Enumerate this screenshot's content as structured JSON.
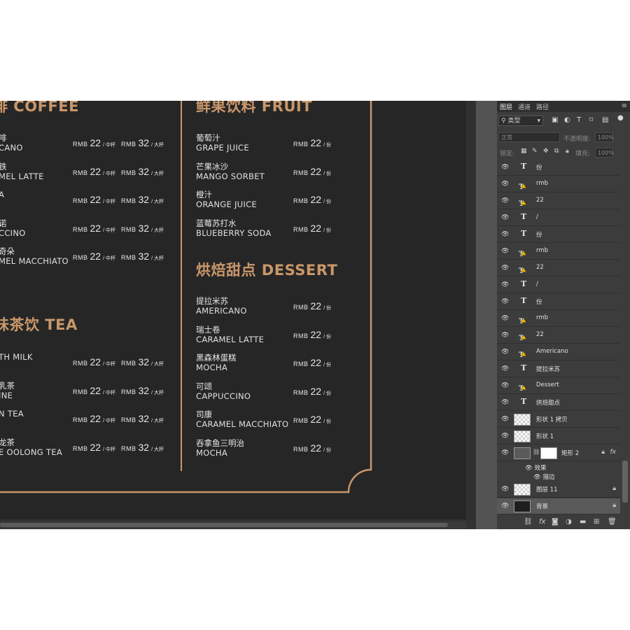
{
  "menu": {
    "coffee_title": "啡 COFFEE",
    "tea_title": "味茶饮 TEA",
    "fruit_title": "鲜果饮料 FRUIT",
    "dessert_title": "烘焙甜点 DESSERT",
    "coffee_items": [
      {
        "cn": "啡",
        "en": "CANO"
      },
      {
        "cn": "铁",
        "en": "MEL LATTE"
      },
      {
        "cn": "",
        "en": "A"
      },
      {
        "cn": "诺",
        "en": "CCINO"
      },
      {
        "cn": "奇朵",
        "en": "MEL MACCHIATO"
      }
    ],
    "tea_items": [
      {
        "cn": "",
        "en": "TH MILK"
      },
      {
        "cn": "乳茶",
        "en": "INE"
      },
      {
        "cn": "",
        "en": "N TEA"
      },
      {
        "cn": "龙茶",
        "en": "E OOLONG TEA"
      }
    ],
    "fruit_items": [
      {
        "cn": "葡萄汁",
        "en": "GRAPE JUICE"
      },
      {
        "cn": "芒果冰沙",
        "en": "MANGO SORBET"
      },
      {
        "cn": "橙汁",
        "en": "ORANGE JUICE"
      },
      {
        "cn": "蓝莓苏打水",
        "en": "BLUEBERRY SODA"
      }
    ],
    "dessert_items": [
      {
        "cn": "提拉米苏",
        "en": "AMERICANO"
      },
      {
        "cn": "瑞士卷",
        "en": "CARAMEL LATTE"
      },
      {
        "cn": "黑森林蛋糕",
        "en": "MOCHA"
      },
      {
        "cn": "可颂",
        "en": "CAPPUCCINO"
      },
      {
        "cn": "司康",
        "en": "CARAMEL MACCHIATO"
      },
      {
        "cn": "吞拿鱼三明治",
        "en": "MOCHA"
      }
    ],
    "price": {
      "currency": "RMB",
      "medium": "22",
      "medium_unit": "/ 中杯",
      "large": "32",
      "large_unit": "/ 大杯",
      "portion_unit": "/ 份"
    }
  },
  "layers_panel": {
    "tabs": [
      "图层",
      "通道",
      "路径"
    ],
    "filter": "类型",
    "blend_mode": "正常",
    "opacity_label": "不透明度:",
    "opacity_value": "100%",
    "lock_label": "锁定:",
    "fill_label": "填充:",
    "fill_value": "100%",
    "layers": [
      {
        "name": "份",
        "kind": "text"
      },
      {
        "name": "rmb",
        "kind": "text-warning"
      },
      {
        "name": "22",
        "kind": "text-warning"
      },
      {
        "name": "/",
        "kind": "text"
      },
      {
        "name": "份",
        "kind": "text"
      },
      {
        "name": "rmb",
        "kind": "text-warning"
      },
      {
        "name": "22",
        "kind": "text-warning"
      },
      {
        "name": "/",
        "kind": "text"
      },
      {
        "name": "份",
        "kind": "text"
      },
      {
        "name": "rmb",
        "kind": "text-warning"
      },
      {
        "name": "22",
        "kind": "text-warning"
      },
      {
        "name": "Americano",
        "kind": "text-warning"
      },
      {
        "name": "提拉米苏",
        "kind": "text"
      },
      {
        "name": "Dessert",
        "kind": "text-warning"
      },
      {
        "name": "烘焙甜点",
        "kind": "text"
      },
      {
        "name": "形状 1 拷贝",
        "kind": "shape"
      },
      {
        "name": "形状 1",
        "kind": "shape"
      },
      {
        "name": "矩形 2",
        "kind": "rect-fx"
      },
      {
        "name": "图层 11",
        "kind": "pixel-locked"
      },
      {
        "name": "背景",
        "kind": "background"
      }
    ],
    "effects_label": "效果",
    "stroke_label": "描边",
    "fx_label": "fx"
  },
  "colors": {
    "accent_gold": "#c9976a",
    "doc_bg": "#262626",
    "panel_bg": "#3c3c3c"
  }
}
